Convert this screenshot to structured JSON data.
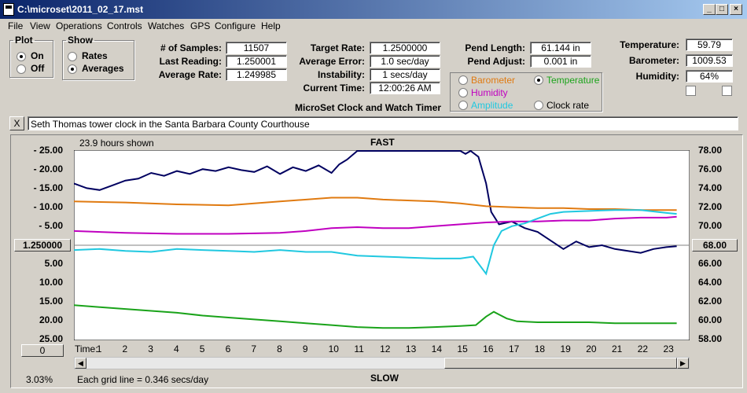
{
  "window": {
    "title": "C:\\microset\\2011_02_17.mst",
    "min": "_",
    "max": "□",
    "close": "×"
  },
  "menu": [
    "File",
    "View",
    "Operations",
    "Controls",
    "Watches",
    "GPS",
    "Configure",
    "Help"
  ],
  "plot_group": {
    "title": "Plot",
    "options": [
      {
        "label": "On",
        "selected": true
      },
      {
        "label": "Off",
        "selected": false
      }
    ]
  },
  "show_group": {
    "title": "Show",
    "options": [
      {
        "label": "Rates",
        "selected": false
      },
      {
        "label": "Averages",
        "selected": true
      }
    ]
  },
  "stats": {
    "samples_label": "# of Samples:",
    "samples": "11507",
    "last_label": "Last Reading:",
    "last": "1.250001",
    "avg_rate_label": "Average Rate:",
    "avg_rate": "1.249985",
    "target_label": "Target Rate:",
    "target": "1.2500000",
    "avg_err_label": "Average Error:",
    "avg_err": "1.0 sec/day",
    "instab_label": "Instability:",
    "instab": "1 secs/day",
    "time_label": "Current Time:",
    "time": "12:00:26 AM",
    "pend_len_label": "Pend Length:",
    "pend_len": "61.144 in",
    "pend_adj_label": "Pend Adjust:",
    "pend_adj": "0.001 in",
    "temp_label": "Temperature:",
    "temp": "59.79",
    "baro_label": "Barometer:",
    "baro": "1009.53",
    "hum_label": "Humidity:",
    "hum": "64%"
  },
  "app_caption": "MicroSet Clock and Watch Timer",
  "sensor_group": [
    {
      "label": "Barometer",
      "color": "#e07a10",
      "selected": false
    },
    {
      "label": "Temperature",
      "color": "#1aa31a",
      "selected": true
    },
    {
      "label": "Humidity",
      "color": "#c000c0",
      "selected": false
    },
    {
      "label": "Amplitude",
      "color": "#20c8e0",
      "selected": false
    },
    {
      "label": "Clock rate",
      "color": "#000000",
      "selected": false
    }
  ],
  "note": {
    "close": "X",
    "text": "Seth Thomas tower clock in the Santa Barbara County Courthouse"
  },
  "chart": {
    "hours_shown": "23.9 hours shown",
    "fast": "FAST",
    "slow": "SLOW",
    "center_btn": "1.250000",
    "right_btn": "68.00",
    "zero_btn": "0",
    "time_label": "Time:",
    "percent": "3.03%",
    "grid_note": "Each grid line = 0.346 secs/day"
  },
  "chart_data": {
    "type": "line",
    "left_ticks": [
      "- 25.00",
      "- 20.00",
      "- 15.00",
      "- 10.00",
      "- 5.00",
      "5.00",
      "10.00",
      "15.00",
      "20.00",
      "25.00"
    ],
    "right_ticks": [
      "78.00",
      "76.00",
      "74.00",
      "72.00",
      "70.00",
      "66.00",
      "64.00",
      "62.00",
      "60.00",
      "58.00"
    ],
    "x_ticks": [
      "1",
      "2",
      "3",
      "4",
      "5",
      "6",
      "7",
      "8",
      "9",
      "10",
      "11",
      "12",
      "13",
      "14",
      "15",
      "16",
      "17",
      "18",
      "19",
      "20",
      "21",
      "22",
      "23"
    ],
    "xlim": [
      0,
      23.9
    ],
    "right_ylim": [
      58,
      78
    ],
    "series": [
      {
        "color": "#000060",
        "x": [
          0,
          0.5,
          1,
          1.5,
          2,
          2.5,
          3,
          3.5,
          4,
          4.5,
          5,
          5.5,
          6,
          6.5,
          7,
          7.5,
          8,
          8.5,
          9,
          9.5,
          10,
          10.3,
          10.6,
          11,
          12,
          13,
          14,
          15,
          15.2,
          15.4,
          15.7,
          16,
          16.2,
          16.5,
          17,
          17.5,
          18,
          18.5,
          19,
          19.5,
          20,
          20.5,
          21,
          21.5,
          22,
          22.5,
          23,
          23.4
        ],
        "y": [
          74.5,
          74.0,
          73.8,
          74.3,
          74.8,
          75.0,
          75.6,
          75.3,
          75.8,
          75.5,
          76.0,
          75.8,
          76.2,
          75.9,
          75.7,
          76.3,
          75.5,
          76.2,
          75.8,
          76.4,
          75.6,
          76.5,
          77.0,
          78,
          78,
          78,
          78,
          78,
          77.6,
          78,
          77.3,
          74.5,
          71.5,
          70.2,
          70.5,
          69.8,
          69.4,
          68.5,
          67.6,
          68.4,
          67.8,
          68.0,
          67.6,
          67.4,
          67.2,
          67.6,
          67.8,
          67.9
        ]
      },
      {
        "color": "#e07a10",
        "x": [
          0,
          2,
          4,
          6,
          8,
          10,
          11,
          12,
          14,
          15,
          16,
          17,
          18,
          19,
          20,
          21,
          22,
          23,
          23.4
        ],
        "y": [
          72.6,
          72.5,
          72.3,
          72.2,
          72.6,
          73.0,
          73.0,
          72.8,
          72.6,
          72.4,
          72.1,
          72.0,
          71.9,
          71.9,
          71.8,
          71.8,
          71.7,
          71.7,
          71.7
        ]
      },
      {
        "color": "#c000c0",
        "x": [
          0,
          2,
          4,
          6,
          8,
          9,
          10,
          11,
          12,
          13,
          14,
          15,
          16,
          17,
          18,
          19,
          20,
          21,
          22,
          23,
          23.4
        ],
        "y": [
          69.5,
          69.3,
          69.2,
          69.2,
          69.3,
          69.5,
          69.8,
          69.9,
          69.8,
          69.8,
          70.0,
          70.2,
          70.4,
          70.5,
          70.5,
          70.6,
          70.6,
          70.8,
          70.9,
          70.9,
          71.0
        ]
      },
      {
        "color": "#20c8e0",
        "x": [
          0,
          1,
          2,
          3,
          4,
          5,
          6,
          7,
          8,
          9,
          10,
          11,
          12,
          13,
          14,
          15,
          15.5,
          16,
          16.3,
          16.6,
          17,
          17.5,
          18,
          18.5,
          19,
          20,
          21,
          22,
          23,
          23.4
        ],
        "y": [
          67.5,
          67.6,
          67.4,
          67.3,
          67.6,
          67.5,
          67.4,
          67.3,
          67.5,
          67.3,
          67.3,
          66.9,
          66.8,
          66.7,
          66.6,
          66.6,
          66.8,
          65.0,
          68.0,
          69.5,
          70.0,
          70.3,
          70.8,
          71.3,
          71.5,
          71.6,
          71.7,
          71.7,
          71.4,
          71.3
        ]
      },
      {
        "color": "#1aa31a",
        "x": [
          0,
          1,
          2,
          3,
          4,
          5,
          6,
          7,
          8,
          9,
          10,
          11,
          12,
          13,
          14,
          15,
          15.6,
          16,
          16.3,
          16.8,
          17.2,
          18,
          19,
          20,
          21,
          22,
          23,
          23.4
        ],
        "y": [
          61.7,
          61.5,
          61.3,
          61.1,
          60.9,
          60.6,
          60.4,
          60.2,
          60.0,
          59.8,
          59.6,
          59.4,
          59.3,
          59.3,
          59.4,
          59.5,
          59.6,
          60.5,
          61.0,
          60.3,
          60.0,
          59.9,
          59.9,
          59.9,
          59.8,
          59.8,
          59.8,
          59.8
        ]
      }
    ]
  }
}
